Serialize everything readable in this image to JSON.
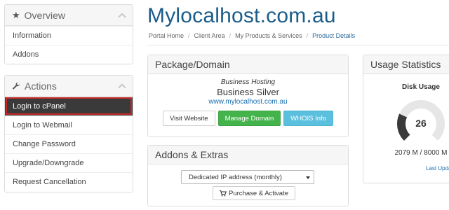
{
  "sidebar": {
    "overview": {
      "title": "Overview",
      "items": [
        {
          "label": "Information"
        },
        {
          "label": "Addons"
        }
      ]
    },
    "actions": {
      "title": "Actions",
      "items": [
        {
          "label": "Login to cPanel",
          "active": true
        },
        {
          "label": "Login to Webmail"
        },
        {
          "label": "Change Password"
        },
        {
          "label": "Upgrade/Downgrade"
        },
        {
          "label": "Request Cancellation"
        }
      ]
    }
  },
  "header": {
    "title": "Mylocalhost.com.au",
    "breadcrumb": [
      "Portal Home",
      "Client Area",
      "My Products & Services",
      "Product Details"
    ]
  },
  "package": {
    "heading": "Package/Domain",
    "group": "Business Hosting",
    "name": "Business Silver",
    "domain": "www.mylocalhost.com.au",
    "buttons": {
      "visit": "Visit Website",
      "manage": "Manage Domain",
      "whois": "WHOIS Info"
    }
  },
  "addons": {
    "heading": "Addons & Extras",
    "selected_option": "Dedicated IP address (monthly)",
    "purchase_label": "Purchase & Activate"
  },
  "usage": {
    "heading": "Usage Statistics",
    "disk_title": "Disk Usage",
    "disk_percent": "26",
    "disk_percent_value": 26,
    "disk_amount": "2079 M / 8000 M",
    "last_updated": "Last Upda"
  },
  "colors": {
    "title_blue": "#1a5c8a",
    "active_bg": "#3a3a3a",
    "highlight_red": "#c62828",
    "green": "#45b34b",
    "blue": "#5bc0de",
    "gauge_fill": "#3a3a3a",
    "gauge_track": "#e6e6e6"
  },
  "icons": [
    "star-icon",
    "wrench-icon",
    "chevron-up-icon",
    "cart-icon",
    "caret-down-icon"
  ]
}
